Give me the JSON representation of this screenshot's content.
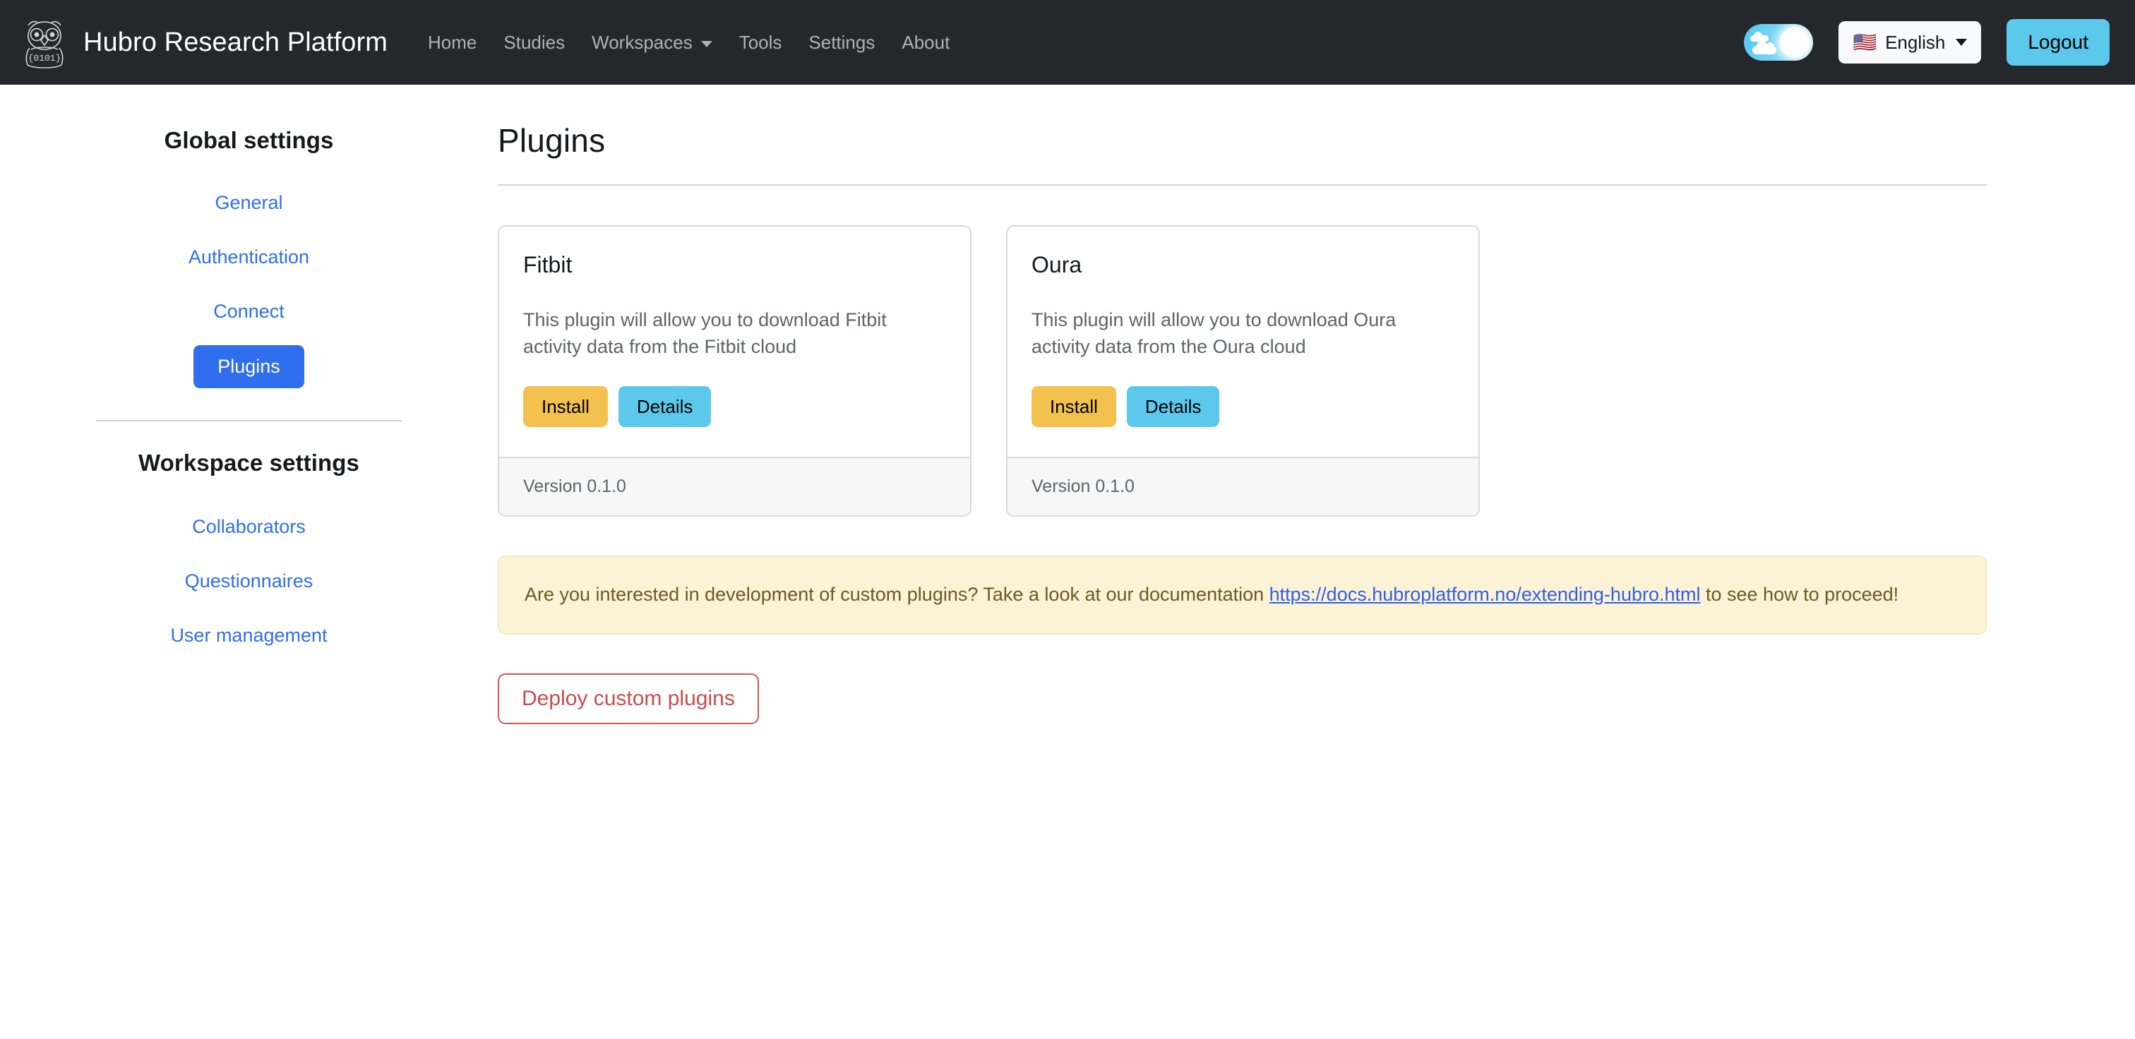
{
  "navbar": {
    "brand_title": "Hubro Research Platform",
    "logo_icon": "owl-logo-icon",
    "logo_binary_text": "{0101}",
    "links": [
      {
        "label": "Home",
        "has_caret": false
      },
      {
        "label": "Studies",
        "has_caret": false
      },
      {
        "label": "Workspaces",
        "has_caret": true
      },
      {
        "label": "Tools",
        "has_caret": false
      },
      {
        "label": "Settings",
        "has_caret": false
      },
      {
        "label": "About",
        "has_caret": false
      }
    ],
    "theme_toggle": {
      "icon": "day-night-toggle-icon",
      "state": "light"
    },
    "language": {
      "flag": "🇺🇸",
      "label": "English",
      "caret_icon": "chevron-down-icon"
    },
    "logout_label": "Logout"
  },
  "sidebar": {
    "global_heading": "Global settings",
    "global_items": [
      {
        "label": "General",
        "active": false
      },
      {
        "label": "Authentication",
        "active": false
      },
      {
        "label": "Connect",
        "active": false
      },
      {
        "label": "Plugins",
        "active": true
      }
    ],
    "workspace_heading": "Workspace settings",
    "workspace_items": [
      {
        "label": "Collaborators"
      },
      {
        "label": "Questionnaires"
      },
      {
        "label": "User management"
      }
    ]
  },
  "main": {
    "title": "Plugins",
    "plugins": [
      {
        "name": "Fitbit",
        "description": "This plugin will allow you to download Fitbit activity data from the Fitbit cloud",
        "install_label": "Install",
        "details_label": "Details",
        "version": "Version 0.1.0"
      },
      {
        "name": "Oura",
        "description": "This plugin will allow you to download Oura activity data from the Oura cloud",
        "install_label": "Install",
        "details_label": "Details",
        "version": "Version 0.1.0"
      }
    ],
    "alert": {
      "text_before": "Are you interested in development of custom plugins? Take a look at our documentation ",
      "link_text": "https://docs.hubroplatform.no/extending-hubro.html",
      "text_after": " to see how to proceed!"
    },
    "deploy_label": "Deploy custom plugins"
  },
  "colors": {
    "navbar_bg": "#24272b",
    "accent_blue": "#2f6fed",
    "link_blue": "#2f6fed",
    "install_amber": "#f2c14e",
    "details_cyan": "#5bc8ec",
    "alert_bg": "#fcf3d7",
    "danger_red": "#d9534f"
  }
}
